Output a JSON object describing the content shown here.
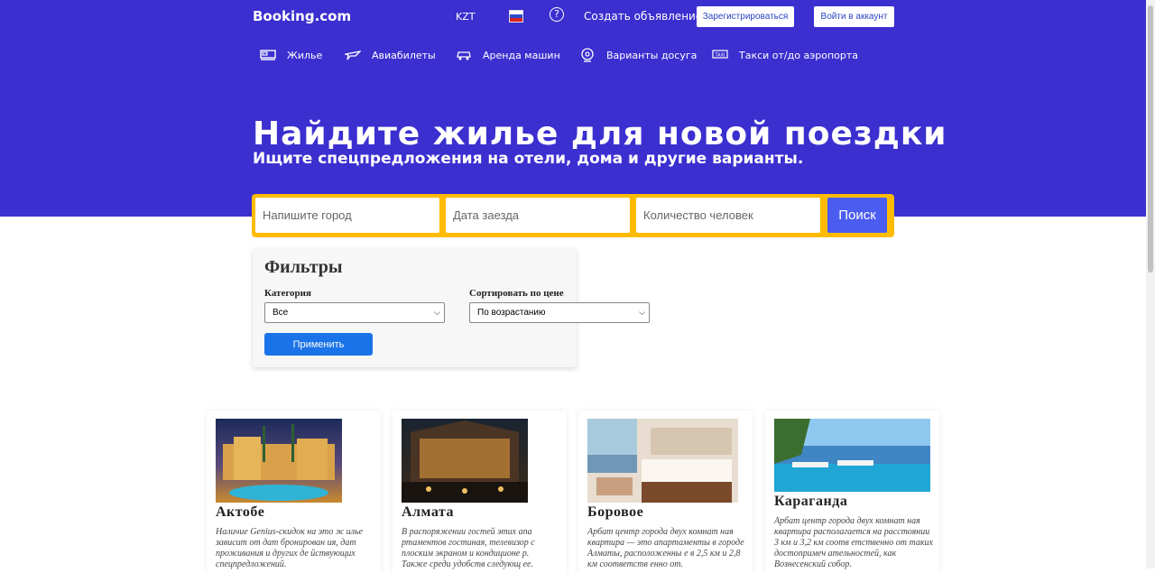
{
  "header": {
    "logo": "Booking.com",
    "currency": "KZT",
    "help_icon": "question-circle-icon",
    "list_property": "Создать объявление",
    "register": "Зарегистрироваться",
    "login": "Войти в аккаунт"
  },
  "nav": [
    {
      "label": "Жилье",
      "icon": "bed-icon"
    },
    {
      "label": "Авиабилеты",
      "icon": "plane-icon"
    },
    {
      "label": "Аренда машин",
      "icon": "car-icon"
    },
    {
      "label": "Варианты досуга",
      "icon": "attraction-icon"
    },
    {
      "label": "Такси от/до аэропорта",
      "icon": "taxi-icon"
    }
  ],
  "hero": {
    "title": "Найдите жилье для новой поездки",
    "subtitle": "Ищите спецпредложения на отели, дома и другие варианты."
  },
  "search": {
    "city_placeholder": "Напишите город",
    "date_placeholder": "Дата заезда",
    "guests_placeholder": "Количество человек",
    "button": "Поиск"
  },
  "filters": {
    "title": "Фильтры",
    "category_label": "Категория",
    "category_value": "Все",
    "sort_label": "Сортировать по цене",
    "sort_value": "По возрастанию",
    "apply": "Применить"
  },
  "cards": [
    {
      "city": "Актобе",
      "text": "Наличие Genius-скидок на это ж илье зависит от дат бронирован ия, дат проживания и других де йствующих спецпредложений."
    },
    {
      "city": "Алмата",
      "text": "В распоряжении гостей этих апа ртаментов гостиная, телевизор с плоским экраном и кондиционе р. Также среди удобств следующ ее."
    },
    {
      "city": "Боровое",
      "text": "Арбат центр города двух комнат ная квартира — это апартаменты в городе Алматы, расположенны е в 2,5 км и 2,8 км соответств енно от."
    },
    {
      "city": "Караганда",
      "text": "Арбат центр города двух комнат ная квартира располагается на расстоянии 3 км и 3,2 км соотв етственно от таких достопримеч ательностей, как Вознесенский собор."
    }
  ],
  "colors": {
    "brand": "#3b2fd0",
    "search_border": "#febb02",
    "apply": "#1a73e8"
  }
}
